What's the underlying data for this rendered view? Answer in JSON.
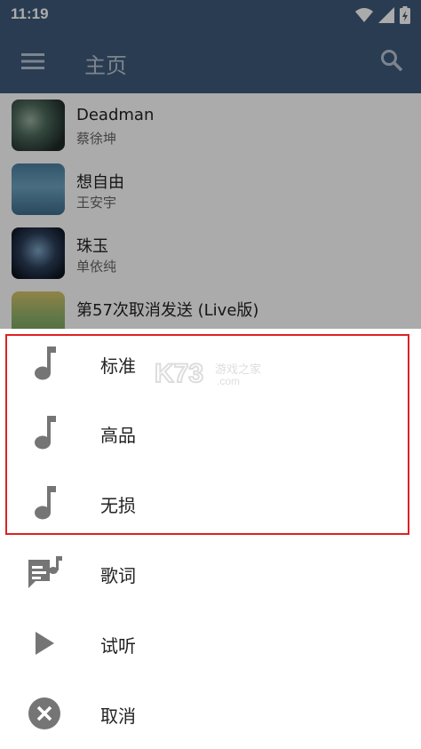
{
  "status_bar": {
    "time": "11:19"
  },
  "app_bar": {
    "title": "主页"
  },
  "songs": [
    {
      "title": "Deadman",
      "artist": "蔡徐坤"
    },
    {
      "title": "想自由",
      "artist": "王安宇"
    },
    {
      "title": "珠玉",
      "artist": "单依纯"
    },
    {
      "title": "第57次取消发送 (Live版)",
      "artist": ""
    }
  ],
  "sheet": {
    "items": [
      {
        "label": "标准",
        "icon": "music-note-icon"
      },
      {
        "label": "高品",
        "icon": "music-note-icon"
      },
      {
        "label": "无损",
        "icon": "music-note-icon"
      },
      {
        "label": "歌词",
        "icon": "lyrics-icon"
      },
      {
        "label": "试听",
        "icon": "play-icon"
      },
      {
        "label": "取消",
        "icon": "cancel-icon"
      }
    ]
  },
  "watermark": {
    "text": "K73",
    "sub": "游戏之家",
    "domain": ".com"
  },
  "colors": {
    "app_bar": "#3f5a7a",
    "icon_gray": "#757575",
    "highlight": "#dd2222"
  }
}
